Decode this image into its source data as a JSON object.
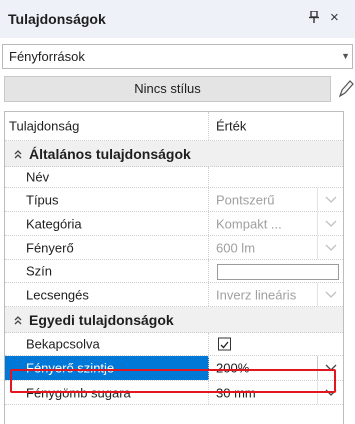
{
  "panel": {
    "title": "Tulajdonságok",
    "pin_glyph": "չ",
    "close_glyph": "×",
    "source_combo": {
      "value": "Fényforrások"
    },
    "style_button": "Nincs stílus"
  },
  "grid": {
    "header": {
      "property": "Tulajdonság",
      "value": "Érték"
    },
    "category_general": "Általános tulajdonságok",
    "category_custom": "Egyedi tulajdonságok",
    "rows_general": [
      {
        "label": "Név",
        "value": ""
      },
      {
        "label": "Típus",
        "value": "Pontszerű"
      },
      {
        "label": "Kategória",
        "value": "Kompakt ..."
      },
      {
        "label": "Fényerő",
        "value": "600 lm"
      },
      {
        "label": "Szín",
        "value": ""
      },
      {
        "label": "Lecsengés",
        "value": "Inverz lineáris"
      }
    ],
    "rows_custom": [
      {
        "label": "Bekapcsolva",
        "checked": true
      },
      {
        "label": "Fényerő szintje",
        "value": "200%"
      },
      {
        "label": "Fénygömb sugara",
        "value": "30 mm"
      }
    ]
  },
  "colors": {
    "selection": "#0078d7",
    "highlight_border": "#e2161f",
    "title_bg": "#eef2f8"
  },
  "icons": [
    "pin-icon",
    "close-icon",
    "chevron-down-icon",
    "pencil-icon",
    "collapse-chevron-icon",
    "checkbox-icon"
  ]
}
